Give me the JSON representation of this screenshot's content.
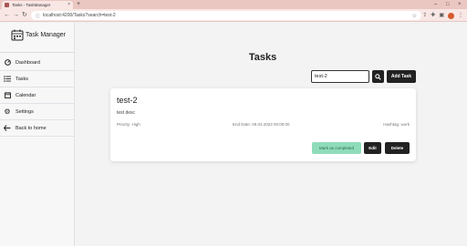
{
  "browser": {
    "tab_title": "Tasks - TaskManager",
    "url": "localhost:4200/Tasks?search=test-2"
  },
  "sidebar": {
    "brand": "Task Manager",
    "items": [
      {
        "label": "Dashboard",
        "icon": "dashboard-icon"
      },
      {
        "label": "Tasks",
        "icon": "tasks-list-icon"
      },
      {
        "label": "Calendar",
        "icon": "calendar-icon"
      },
      {
        "label": "Settings",
        "icon": "gear-icon"
      },
      {
        "label": "Back to home",
        "icon": "back-arrow-icon"
      }
    ]
  },
  "main": {
    "title": "Tasks",
    "search_value": "test-2",
    "add_task_label": "Add Task"
  },
  "task": {
    "title": "test-2",
    "description": "test desc",
    "priority": "Priority: High",
    "end_date": "End Date: 09.03.2023 00:00:00",
    "hashtag": "Hashtag: work",
    "complete_label": "Mark as completed",
    "edit_label": "Edit",
    "delete_label": "Delete"
  },
  "colors": {
    "complete_button": "#8fdcba",
    "primary_button": "#222222",
    "browser_chrome": "#ebc7c2"
  }
}
